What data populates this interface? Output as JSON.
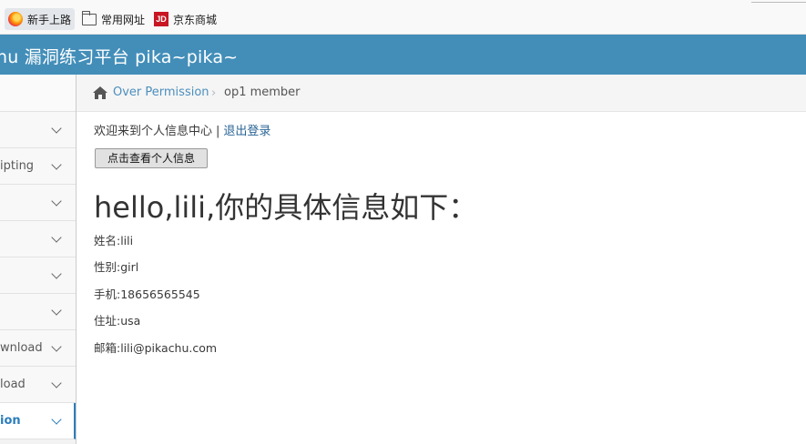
{
  "bookmarks": [
    {
      "label": "新手上路",
      "icon": "firefox-icon"
    },
    {
      "label": "常用网址",
      "icon": "folder-icon"
    },
    {
      "label": "京东商城",
      "icon": "jd-icon"
    }
  ],
  "header": {
    "title": "hu 漏洞练习平台 pika~pika~"
  },
  "sidebar": {
    "items": [
      {
        "label": ""
      },
      {
        "label": "ipting"
      },
      {
        "label": ""
      },
      {
        "label": ""
      },
      {
        "label": ""
      },
      {
        "label": ""
      },
      {
        "label": "wnload"
      },
      {
        "label": "load"
      },
      {
        "label": "ion"
      }
    ]
  },
  "breadcrumb": {
    "link": "Over Permission",
    "separator": "›",
    "current": "op1 member"
  },
  "main": {
    "welcome": "欢迎来到个人信息中心",
    "separator": "|",
    "logout": "退出登录",
    "view_button": "点击查看个人信息",
    "heading": "hello,lili,你的具体信息如下：",
    "fields": [
      {
        "text": "姓名:lili"
      },
      {
        "text": "性别:girl"
      },
      {
        "text": "手机:18656565545"
      },
      {
        "text": "住址:usa"
      },
      {
        "text": "邮箱:lili@pikachu.com"
      }
    ]
  },
  "colors": {
    "header": "#438eb9",
    "link": "#4c8fbd",
    "active": "#2b7dbc"
  }
}
